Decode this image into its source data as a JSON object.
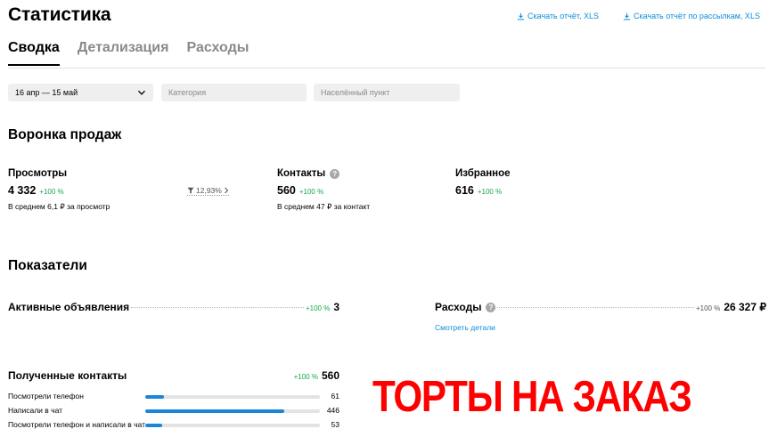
{
  "header": {
    "title": "Статистика",
    "download_report": "Скачать отчёт, XLS",
    "download_mailing_report": "Скачать отчёт по рассылкам, XLS"
  },
  "tabs": [
    {
      "label": "Сводка",
      "active": true
    },
    {
      "label": "Детализация",
      "active": false
    },
    {
      "label": "Расходы",
      "active": false
    }
  ],
  "filters": {
    "date_range": "16 апр — 15 май",
    "category_placeholder": "Категория",
    "city_placeholder": "Населённый пункт"
  },
  "funnel": {
    "title": "Воронка продаж",
    "views": {
      "label": "Просмотры",
      "value": "4 332",
      "change": "+100 %",
      "sub": "В среднем 6,1 ₽ за просмотр"
    },
    "conversion": "12,93%",
    "contacts": {
      "label": "Контакты",
      "value": "560",
      "change": "+100 %",
      "sub": "В среднем 47 ₽ за контакт"
    },
    "favorites": {
      "label": "Избранное",
      "value": "616",
      "change": "+100 %"
    }
  },
  "indicators": {
    "title": "Показатели",
    "active_ads": {
      "label": "Активные объявления",
      "change": "+100 %",
      "value": "3"
    },
    "expenses": {
      "label": "Расходы",
      "change": "+100 %",
      "value": "26 327 ₽",
      "details_link": "Смотреть детали"
    },
    "received_contacts": {
      "label": "Полученные контакты",
      "change": "+100 %",
      "value": "560",
      "rows": [
        {
          "label": "Посмотрели телефон",
          "value": "61",
          "fraction": 0.109
        },
        {
          "label": "Написали в чат",
          "value": "446",
          "fraction": 0.796
        },
        {
          "label": "Посмотрели телефон и написали в чат",
          "value": "53",
          "fraction": 0.095
        }
      ]
    }
  },
  "overlay": {
    "text": "ТОРТЫ НА ЗАКАЗ",
    "color": "#ff0000"
  },
  "colors": {
    "link": "#0a8fd8",
    "positive": "#1aa74a",
    "bar": "#1b86d8"
  },
  "icons": {
    "download": "download-icon",
    "chevron": "chevron-down-icon",
    "help": "help-icon",
    "filter": "funnel-filter-icon"
  }
}
